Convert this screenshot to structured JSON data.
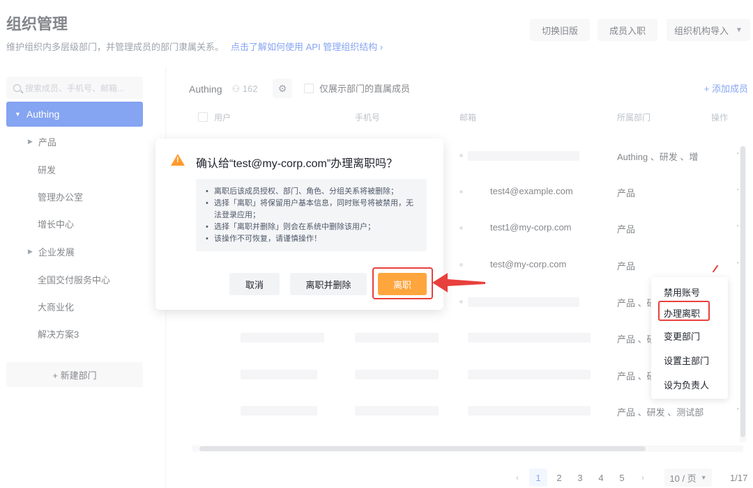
{
  "header": {
    "title": "组织管理",
    "description": "维护组织内多层级部门，并管理成员的部门隶属关系。",
    "help_link": "点击了解如何使用 API 管理组织结构 ›",
    "buttons": {
      "switch_old": "切换旧版",
      "member_onboard": "成员入职",
      "org_import": "组织机构导入"
    }
  },
  "sidebar": {
    "search_placeholder": "搜索成员、手机号、邮箱...",
    "root": "Authing",
    "items": [
      "产品",
      "研发",
      "管理办公室",
      "增长中心",
      "企业发展",
      "全国交付服务中心",
      "大商业化",
      "解决方案3"
    ],
    "new_dept": "+ 新建部门"
  },
  "main": {
    "org_name": "Authing",
    "member_count": "162",
    "direct_only_label": "仅展示部门的直属成员",
    "add_member": "+ 添加成员",
    "columns": [
      "用户",
      "手机号",
      "邮箱",
      "所属部门",
      "操作"
    ],
    "rows": [
      {
        "email": "",
        "dept": "Authing 、研发 、增"
      },
      {
        "email": "test4@example.com",
        "dept": "产品"
      },
      {
        "email": "test1@my-corp.com",
        "dept": "产品"
      },
      {
        "email": "test@my-corp.com",
        "dept": "产品"
      },
      {
        "email": "",
        "dept": "产品 、研"
      },
      {
        "email": "",
        "dept": "产品 、研"
      },
      {
        "email": "",
        "dept": "产品 、研"
      },
      {
        "email": "",
        "dept": "产品 、研发 、测试部"
      }
    ],
    "more": "···"
  },
  "pagination": {
    "pages": [
      "1",
      "2",
      "3",
      "4",
      "5"
    ],
    "prev": "‹",
    "next": "›",
    "page_size": "10 / 页",
    "total": "1/17"
  },
  "dropdown": {
    "items": [
      "禁用账号",
      "办理离职",
      "变更部门",
      "设置主部门",
      "设为负责人"
    ]
  },
  "modal": {
    "title": "确认给“test@my-corp.com”办理离职吗？",
    "notes": [
      "离职后该成员授权、部门、角色、分组关系将被删除；",
      "选择「离职」将保留用户基本信息，同时账号将被禁用，无法登录应用；",
      "选择「离职并删除」则会在系统中删除该用户；",
      "该操作不可恢复，请谨慎操作！"
    ],
    "buttons": {
      "cancel": "取消",
      "resign_delete": "离职并删除",
      "resign": "离职"
    }
  },
  "colors": {
    "primary": "#215ae5",
    "warning": "#ff9a2e",
    "resign_button": "#ffa53d",
    "annotation": "#e8403d"
  }
}
